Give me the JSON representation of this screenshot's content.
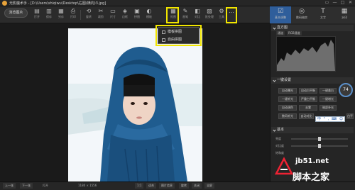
{
  "app": {
    "title": "光影魔术手 - [D:\\Users\\shiqiwu\\Desktop\\右图(横向)3.jpg]"
  },
  "window_controls": [
    "▭",
    "—",
    "□",
    "✕"
  ],
  "toolbar": {
    "open_label": "浏览图片",
    "tools": [
      {
        "glyph": "▤",
        "label": "打开"
      },
      {
        "glyph": "▥",
        "label": "保存"
      },
      {
        "glyph": "▦",
        "label": "另存"
      },
      {
        "glyph": "⎙",
        "label": "打印"
      },
      {
        "glyph": "⟲",
        "label": "旋转"
      },
      {
        "glyph": "✂",
        "label": "裁剪"
      },
      {
        "glyph": "▭",
        "label": "尺寸"
      },
      {
        "glyph": "◈",
        "label": "边框"
      },
      {
        "glyph": "▣",
        "label": "拼图"
      },
      {
        "glyph": "◐",
        "label": "模板"
      },
      {
        "glyph": "▦",
        "label": "抠图"
      },
      {
        "glyph": "✎",
        "label": "画笔"
      },
      {
        "glyph": "◧",
        "label": "对比"
      },
      {
        "glyph": "▨",
        "label": "批处理"
      },
      {
        "glyph": "⚙",
        "label": "工具"
      },
      {
        "glyph": "…",
        "label": ""
      }
    ]
  },
  "menu": {
    "items": [
      "模板拼图",
      "自由拼图"
    ]
  },
  "right_tabs": [
    {
      "glyph": "☑",
      "label": "基本调整"
    },
    {
      "glyph": "◎",
      "label": "数码暗房"
    },
    {
      "glyph": "T",
      "label": "文字"
    },
    {
      "glyph": "▦",
      "label": "水印"
    }
  ],
  "histogram": {
    "title": "直方图",
    "channel_label": "通道",
    "channel_value": "RGB通道"
  },
  "quick": {
    "title": "一键设置",
    "buttons": [
      "自动曝光",
      "自动白平衡",
      "一键美白",
      "一键补光",
      "严重白平衡",
      "一键增光",
      "自动调色",
      "去雾",
      "暗部补光",
      "数码补光",
      "自动对比",
      "白平衡"
    ],
    "gauge_value": "74"
  },
  "ime": {
    "items": [
      "中",
      "°",
      ",",
      "⌨",
      "☺"
    ]
  },
  "basic": {
    "title": "基本",
    "rows": [
      "亮度",
      "对比度",
      "饱和度"
    ]
  },
  "status": {
    "prev": "上一张",
    "next": "下一张",
    "info": "1180 × 1556",
    "zoom_labels": [
      "1:1",
      "适合",
      "图片信息",
      "旋转",
      "关闭",
      "全屏"
    ],
    "bottom_tip": "打开"
  },
  "watermark": {
    "site": "jb51.net",
    "name": "脚本之家"
  }
}
